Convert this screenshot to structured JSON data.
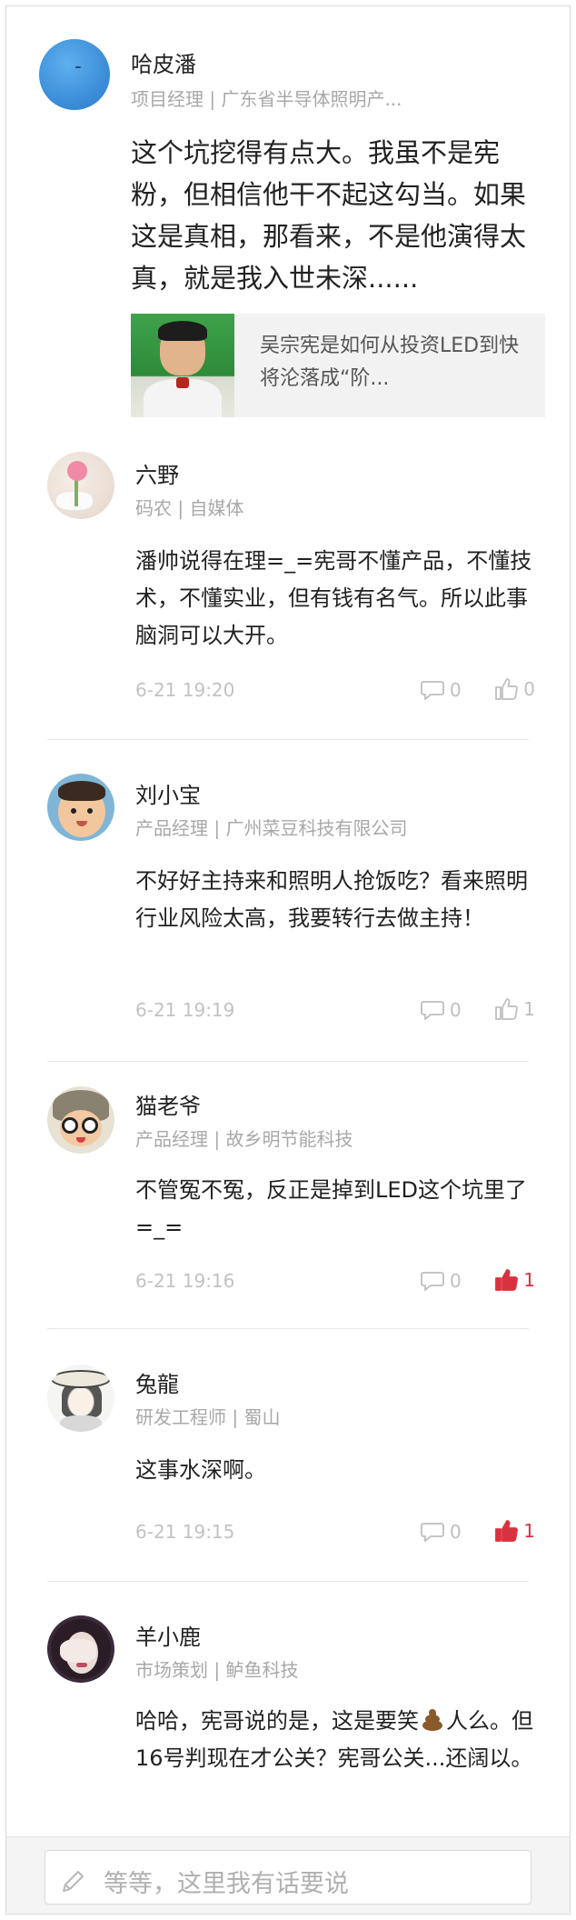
{
  "post": {
    "author": "哈皮潘",
    "meta": "项目经理 | 广东省半导体照明产...",
    "content": "这个坑挖得有点大。我虽不是宪粉，但相信他干不起这勾当。如果这是真相，那看来，不是他演得太真，就是我入世未深......",
    "link_title": "吴宗宪是如何从投资LED到快将沦落成“阶..."
  },
  "comments": [
    {
      "author": "六野",
      "meta": "码农 | 自媒体",
      "text": "潘帅说得在理=_=宪哥不懂产品，不懂技术，不懂实业，但有钱有名气。所以此事脑洞可以大开。",
      "time": "6-21 19:20",
      "replies": "0",
      "likes": "0",
      "liked": false
    },
    {
      "author": "刘小宝",
      "meta": "产品经理 | 广州菜豆科技有限公司",
      "text": "不好好主持来和照明人抢饭吃？看来照明行业风险太高，我要转行去做主持！",
      "time": "6-21 19:19",
      "replies": "0",
      "likes": "1",
      "liked": false
    },
    {
      "author": "猫老爷",
      "meta": "产品经理 | 故乡明节能科技",
      "text": "不管冤不冤，反正是掉到LED这个坑里了=_=",
      "time": "6-21 19:16",
      "replies": "0",
      "likes": "1",
      "liked": true
    },
    {
      "author": "兔龍",
      "meta": "研发工程师 | 蜀山",
      "text": "这事水深啊。",
      "time": "6-21 19:15",
      "replies": "0",
      "likes": "1",
      "liked": true
    },
    {
      "author": "羊小鹿",
      "meta": "市场策划 | 鲈鱼科技",
      "text_before_emoji": "哈哈，宪哥说的是，这是要笑",
      "text_after_emoji": "人么。但16号判现在才公关？宪哥公关...还阔以。"
    }
  ],
  "input": {
    "placeholder": "等等，这里我有话要说"
  },
  "icons": {
    "reply": "comment-bubble-icon",
    "like": "thumbs-up-icon",
    "pencil": "pencil-icon",
    "emoji": "poop-emoji"
  },
  "colors": {
    "like_active": "#d9323f",
    "meta_gray": "#a8a8a8",
    "divider": "#e6e6e6"
  }
}
